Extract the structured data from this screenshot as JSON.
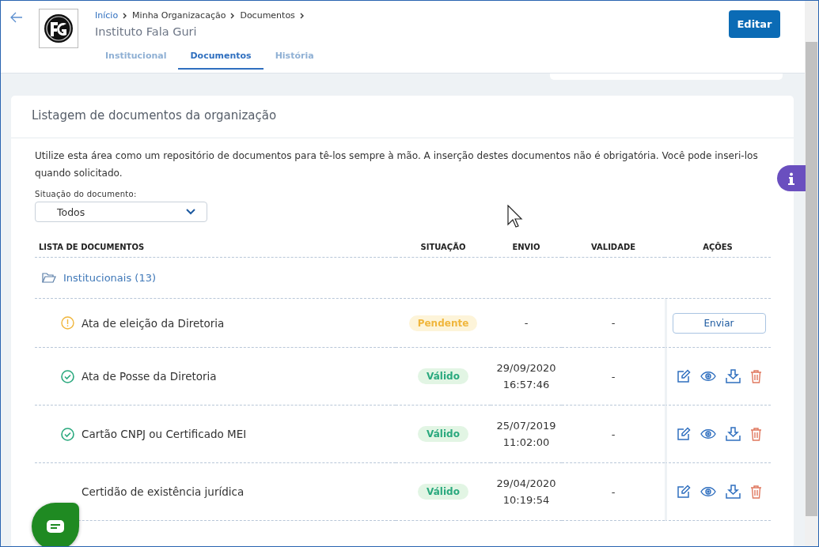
{
  "header": {
    "breadcrumb": [
      {
        "label": "Início",
        "link": true
      },
      {
        "label": "Minha Organizacação",
        "link": false
      },
      {
        "label": "Documentos",
        "link": false
      }
    ],
    "title": "Instituto Fala Guri",
    "tabs": [
      {
        "label": "Institucional",
        "selected": false
      },
      {
        "label": "Documentos",
        "selected": true
      },
      {
        "label": "História",
        "selected": false
      }
    ],
    "edit_button": "Editar"
  },
  "card": {
    "title": "Listagem de documentos da organização",
    "intro": "Utilize esta área como um repositório de documentos para tê-los sempre à mão. A inserção destes documentos não é obrigatória. Você pode inseri-los quando solicitado.",
    "filter": {
      "label": "Situação do documento:",
      "value": "Todos"
    },
    "table": {
      "columns": [
        "LISTA DE DOCUMENTOS",
        "SITUAÇÃO",
        "ENVIO",
        "VALIDADE",
        "AÇÕES"
      ],
      "group": {
        "label": "Institucionais (13)",
        "expanded": true
      },
      "rows": [
        {
          "name": "Ata de eleição da Diretoria",
          "kind": "pending",
          "status_label": "Pendente",
          "icon": true,
          "sent": [
            "-"
          ],
          "validity": "-",
          "actions": [
            {
              "kind": "button",
              "label": "Enviar"
            }
          ]
        },
        {
          "name": "Ata de Posse da Diretoria",
          "kind": "valid",
          "status_label": "Válido",
          "icon": true,
          "sent": [
            "29/09/2020",
            "16:57:46"
          ],
          "validity": "-",
          "actions": [
            {
              "kind": "edit"
            },
            {
              "kind": "view"
            },
            {
              "kind": "download"
            },
            {
              "kind": "delete"
            }
          ]
        },
        {
          "name": "Cartão CNPJ ou Certificado MEI",
          "kind": "valid",
          "status_label": "Válido",
          "icon": true,
          "sent": [
            "25/07/2019",
            "11:02:00"
          ],
          "validity": "-",
          "actions": [
            {
              "kind": "edit"
            },
            {
              "kind": "view"
            },
            {
              "kind": "download"
            },
            {
              "kind": "delete"
            }
          ]
        },
        {
          "name": "Certidão de existência jurídica",
          "kind": "valid",
          "status_label": "Válido",
          "icon": false,
          "sent": [
            "29/04/2020",
            "10:19:54"
          ],
          "validity": "-",
          "actions": [
            {
              "kind": "edit"
            },
            {
              "kind": "view"
            },
            {
              "kind": "download"
            },
            {
              "kind": "delete"
            }
          ]
        }
      ]
    }
  }
}
